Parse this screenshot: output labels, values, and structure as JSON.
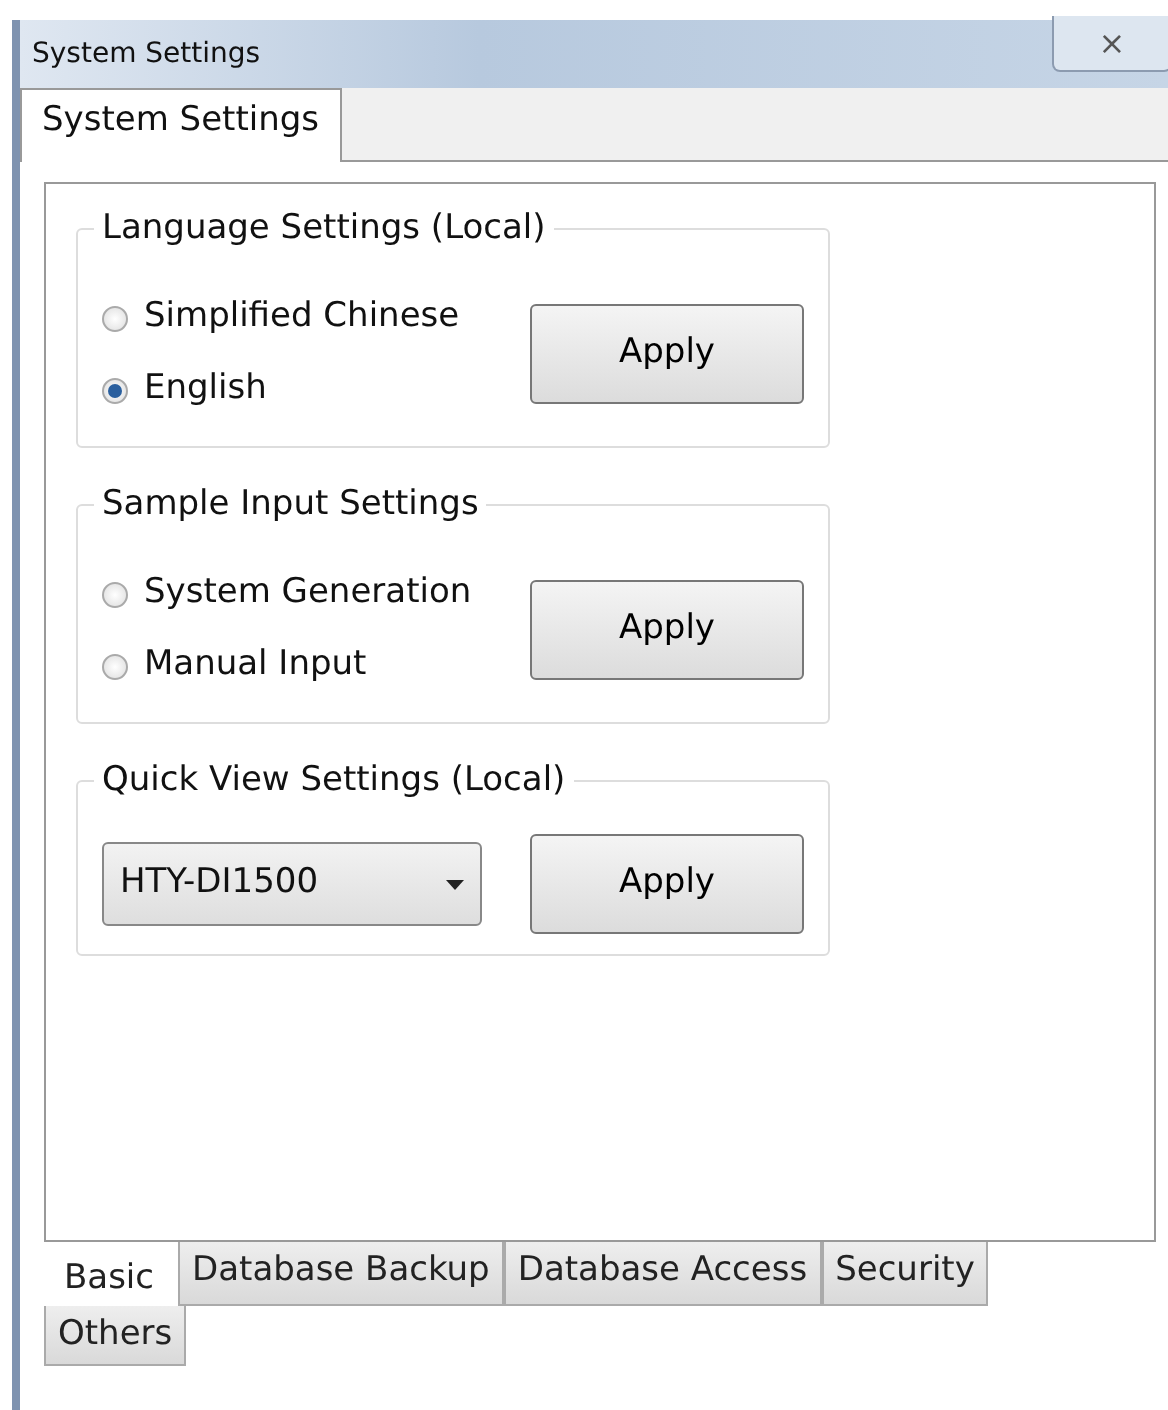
{
  "window": {
    "title": "System Settings",
    "close": "⨯"
  },
  "top_tabs": [
    {
      "label": "System Settings",
      "selected": true
    }
  ],
  "groups": [
    {
      "title": "Language Settings (Local)",
      "kind": "radios",
      "options": [
        {
          "label": "Simplified Chinese",
          "selected": false
        },
        {
          "label": "English",
          "selected": true
        }
      ],
      "button": "Apply"
    },
    {
      "title": "Sample Input Settings",
      "kind": "radios",
      "options": [
        {
          "label": "System Generation",
          "selected": false
        },
        {
          "label": "Manual Input",
          "selected": false
        }
      ],
      "button": "Apply"
    },
    {
      "title": "Quick View Settings (Local)",
      "kind": "select",
      "value": "HTY-DI1500",
      "button": "Apply"
    }
  ],
  "bottom_tabs": [
    [
      {
        "label": "Basic",
        "selected": true
      },
      {
        "label": "Database Backup",
        "selected": false
      },
      {
        "label": "Database Access",
        "selected": false
      },
      {
        "label": "Security",
        "selected": false
      }
    ],
    [
      {
        "label": "Others",
        "selected": false
      }
    ]
  ]
}
